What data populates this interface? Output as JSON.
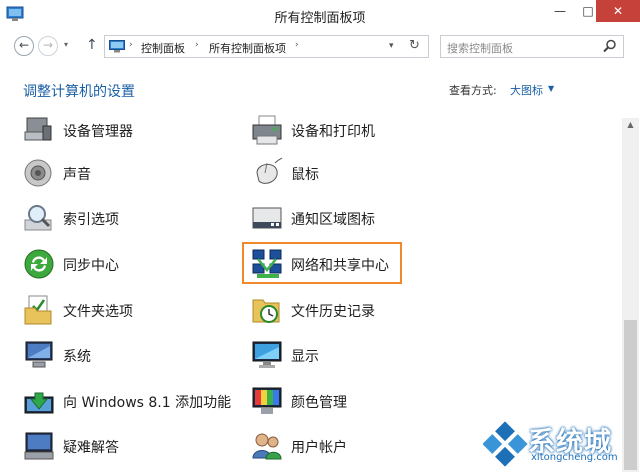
{
  "window": {
    "title": "所有控制面板项",
    "controls": {
      "minimize": "—",
      "maximize": "□",
      "close": "✕"
    }
  },
  "nav": {
    "back": "←",
    "forward": "→",
    "dropdown": "▾",
    "up": "↑",
    "breadcrumb_sep": "›",
    "breadcrumbs": [
      "控制面板",
      "所有控制面板项"
    ],
    "address_dropdown": "▾",
    "refresh": "↻",
    "search_placeholder": "搜索控制面板"
  },
  "header": {
    "heading": "调整计算机的设置",
    "view_by_label": "查看方式:",
    "view_by_value": "大图标",
    "view_by_arrow": "▼"
  },
  "items": [
    {
      "label": "设备管理器",
      "icon": "device-manager-icon"
    },
    {
      "label": "设备和打印机",
      "icon": "printer-icon"
    },
    {
      "label": "声音",
      "icon": "speaker-icon"
    },
    {
      "label": "鼠标",
      "icon": "mouse-icon"
    },
    {
      "label": "索引选项",
      "icon": "magnifier-icon"
    },
    {
      "label": "通知区域图标",
      "icon": "taskbar-icon"
    },
    {
      "label": "同步中心",
      "icon": "sync-icon"
    },
    {
      "label": "网络和共享中心",
      "icon": "network-icon"
    },
    {
      "label": "文件夹选项",
      "icon": "folder-check-icon"
    },
    {
      "label": "文件历史记录",
      "icon": "file-history-icon"
    },
    {
      "label": "系统",
      "icon": "computer-icon"
    },
    {
      "label": "显示",
      "icon": "monitor-icon"
    },
    {
      "label": "向 Windows 8.1 添加功能",
      "icon": "add-features-icon"
    },
    {
      "label": "颜色管理",
      "icon": "color-management-icon"
    },
    {
      "label": "疑难解答",
      "icon": "troubleshooting-icon"
    },
    {
      "label": "用户帐户",
      "icon": "users-icon"
    }
  ],
  "highlighted_item": "网络和共享中心",
  "scrollbar": {
    "up_arrow": "▲",
    "position_fraction": 0.95
  },
  "watermark": {
    "text": "系统城",
    "url": "xitongcheng.com"
  },
  "colors": {
    "accent_blue": "#1b5fa5",
    "highlight_orange": "#f0892a",
    "close_red": "#c7413b"
  }
}
